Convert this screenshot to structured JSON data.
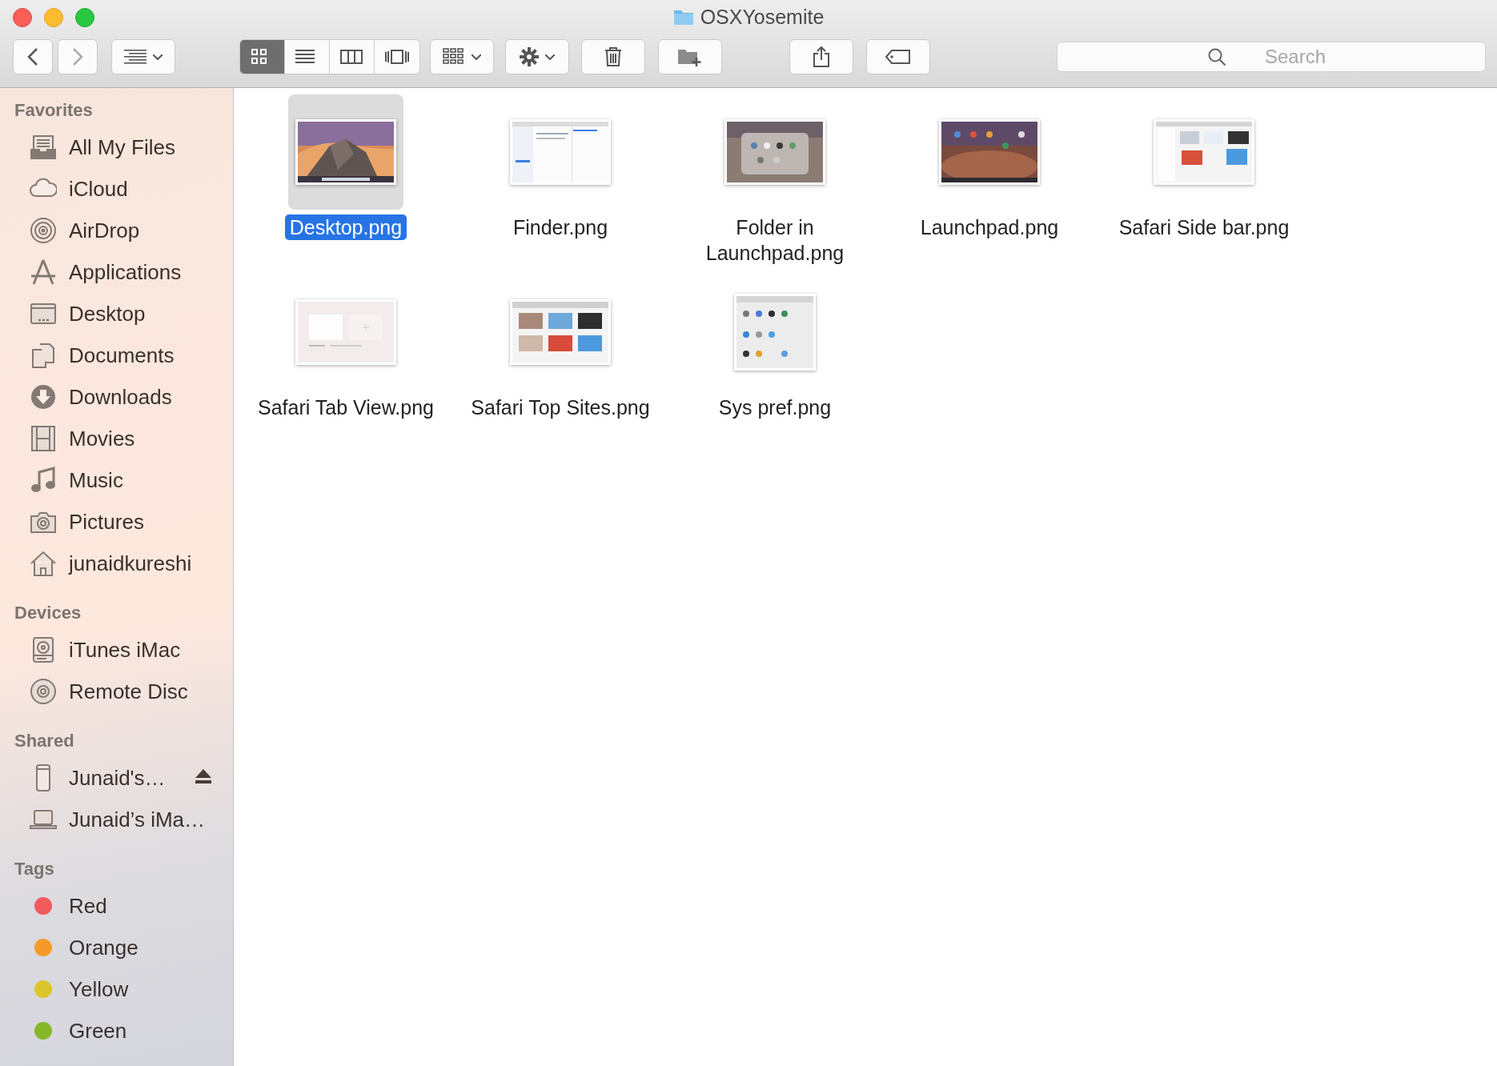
{
  "window": {
    "title": "OSXYosemite"
  },
  "toolbar": {
    "view_modes": [
      {
        "selected": true
      },
      {
        "selected": false
      },
      {
        "selected": false
      },
      {
        "selected": false
      }
    ],
    "search": {
      "placeholder": "Search"
    }
  },
  "sidebar": {
    "sections": [
      {
        "heading": "Favorites",
        "items": [
          {
            "kind": "place",
            "label": "All My Files"
          },
          {
            "kind": "place",
            "label": "iCloud"
          },
          {
            "kind": "place",
            "label": "AirDrop"
          },
          {
            "kind": "place",
            "label": "Applications"
          },
          {
            "kind": "place",
            "label": "Desktop"
          },
          {
            "kind": "place",
            "label": "Documents"
          },
          {
            "kind": "place",
            "label": "Downloads"
          },
          {
            "kind": "place",
            "label": "Movies"
          },
          {
            "kind": "place",
            "label": "Music"
          },
          {
            "kind": "place",
            "label": "Pictures"
          },
          {
            "kind": "place",
            "label": "junaidkureshi"
          }
        ]
      },
      {
        "heading": "Devices",
        "items": [
          {
            "kind": "place",
            "label": "iTunes iMac"
          },
          {
            "kind": "place",
            "label": "Remote Disc"
          }
        ]
      },
      {
        "heading": "Shared",
        "items": [
          {
            "kind": "place",
            "label": "Junaid's…",
            "ejectable": true
          },
          {
            "kind": "place",
            "label": "Junaid’s iMa…",
            "ejectable": false
          }
        ]
      },
      {
        "heading": "Tags",
        "items": [
          {
            "kind": "tag",
            "label": "Red",
            "color": "#f25b5b"
          },
          {
            "kind": "tag",
            "label": "Orange",
            "color": "#f49a2a"
          },
          {
            "kind": "tag",
            "label": "Yellow",
            "color": "#dcc52a"
          },
          {
            "kind": "tag",
            "label": "Green",
            "color": "#88b82a"
          }
        ]
      }
    ]
  },
  "files": [
    {
      "name": "Desktop.png",
      "selected": true
    },
    {
      "name": "Finder.png",
      "selected": false
    },
    {
      "name": "Folder in Launchpad.png",
      "selected": false
    },
    {
      "name": "Launchpad.png",
      "selected": false
    },
    {
      "name": "Safari Side bar.png",
      "selected": false
    },
    {
      "name": "Safari Tab View.png",
      "selected": false
    },
    {
      "name": "Safari Top Sites.png",
      "selected": false
    },
    {
      "name": "Sys pref.png",
      "selected": false
    }
  ]
}
